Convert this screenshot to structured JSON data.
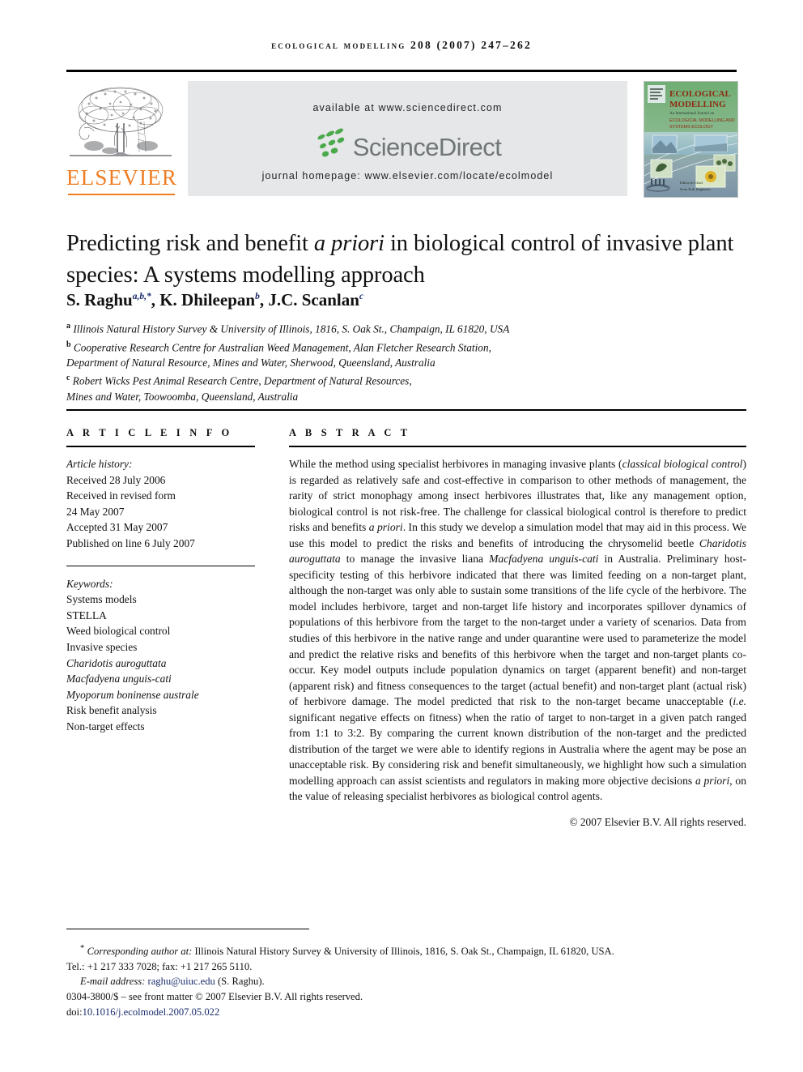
{
  "running_head": "Ecological Modelling 208 (2007) 247–262",
  "masthead": {
    "publisher_name": "ELSEVIER",
    "available_at": "available at www.sciencedirect.com",
    "sciencedirect_wordmark": "ScienceDirect",
    "journal_homepage": "journal homepage: www.elsevier.com/locate/ecolmodel",
    "cover": {
      "journal_title_line1": "ECOLOGICAL",
      "journal_title_line2": "MODELLING",
      "subtitle": "An International Journal on",
      "scope_line1": "ECOLOGICAL MODELLING AND",
      "scope_line2": "SYSTEMS ECOLOGY",
      "editor_label": "Editor-in-Chief",
      "editor_name": "Sven Erik Jørgensen"
    },
    "accent_color": "#ef7d22",
    "panel_color": "#e5e7e8",
    "wordmark_color": "#6f7674",
    "leaf_color": "#4aa94a"
  },
  "article": {
    "title_part1": "Predicting risk and benefit ",
    "title_italic": "a priori",
    "title_part2": " in biological control of invasive plant species: A systems modelling approach",
    "authors": [
      {
        "name": "S. Raghu",
        "marks": "a,b,*"
      },
      {
        "name": "K. Dhileepan",
        "marks": "b"
      },
      {
        "name": "J.C. Scanlan",
        "marks": "c"
      }
    ],
    "affiliations": [
      {
        "mark": "a",
        "lines": [
          "Illinois Natural History Survey & University of Illinois, 1816, S. Oak St., Champaign, IL 61820, USA"
        ]
      },
      {
        "mark": "b",
        "lines": [
          "Cooperative Research Centre for Australian Weed Management, Alan Fletcher Research Station,",
          "Department of Natural Resource, Mines and Water, Sherwood, Queensland, Australia"
        ]
      },
      {
        "mark": "c",
        "lines": [
          "Robert Wicks Pest Animal Research Centre, Department of Natural Resources,",
          "Mines and Water, Toowoomba, Queensland, Australia"
        ]
      }
    ]
  },
  "article_info": {
    "heading": "A R T I C L E    I N F O",
    "history_label": "Article history:",
    "history_lines": [
      "Received 28 July 2006",
      "Received in revised form",
      "24 May 2007",
      "Accepted 31 May 2007",
      "Published on line 6 July 2007"
    ],
    "keywords_label": "Keywords:",
    "keywords": [
      {
        "text": "Systems models",
        "italic": false
      },
      {
        "text": "STELLA",
        "italic": false
      },
      {
        "text": "Weed biological control",
        "italic": false
      },
      {
        "text": "Invasive species",
        "italic": false
      },
      {
        "text": "Charidotis auroguttata",
        "italic": true
      },
      {
        "text": "Macfadyena unguis-cati",
        "italic": true
      },
      {
        "text": "Myoporum boninense australe",
        "italic": true
      },
      {
        "text": "Risk benefit analysis",
        "italic": false
      },
      {
        "text": "Non-target effects",
        "italic": false
      }
    ]
  },
  "abstract": {
    "heading": "A B S T R A C T",
    "segments": [
      {
        "t": "While the method using specialist herbivores in managing invasive plants (",
        "i": false
      },
      {
        "t": "classical biological control",
        "i": true
      },
      {
        "t": ") is regarded as relatively safe and cost-effective in comparison to other methods of management, the rarity of strict monophagy among insect herbivores illustrates that, like any management option, biological control is not risk-free. The challenge for classical biological control is therefore to predict risks and benefits ",
        "i": false
      },
      {
        "t": "a priori",
        "i": true
      },
      {
        "t": ". In this study we develop a simulation model that may aid in this process. We use this model to predict the risks and benefits of introducing the chrysomelid beetle ",
        "i": false
      },
      {
        "t": "Charidotis auroguttata",
        "i": true
      },
      {
        "t": " to manage the invasive liana ",
        "i": false
      },
      {
        "t": "Macfadyena unguis-cati",
        "i": true
      },
      {
        "t": " in Australia. Preliminary host-specificity testing of this herbivore indicated that there was limited feeding on a non-target plant, although the non-target was only able to sustain some transitions of the life cycle of the herbivore. The model includes herbivore, target and non-target life history and incorporates spillover dynamics of populations of this herbivore from the target to the non-target under a variety of scenarios. Data from studies of this herbivore in the native range and under quarantine were used to parameterize the model and predict the relative risks and benefits of this herbivore when the target and non-target plants co-occur. Key model outputs include population dynamics on target (apparent benefit) and non-target (apparent risk) and fitness consequences to the target (actual benefit) and non-target plant (actual risk) of herbivore damage. The model predicted that risk to the non-target became unacceptable (",
        "i": false
      },
      {
        "t": "i.e.",
        "i": true
      },
      {
        "t": " significant negative effects on fitness) when the ratio of target to non-target in a given patch ranged from 1:1 to 3:2. By comparing the current known distribution of the non-target and the predicted distribution of the target we were able to identify regions in Australia where the agent may be pose an unacceptable risk. By considering risk and benefit simultaneously, we highlight how such a simulation modelling approach can assist scientists and regulators in making more objective decisions ",
        "i": false
      },
      {
        "t": "a priori",
        "i": true
      },
      {
        "t": ", on the value of releasing specialist herbivores as biological control agents.",
        "i": false
      }
    ],
    "copyright": "© 2007 Elsevier B.V. All rights reserved."
  },
  "footer": {
    "corresponding_marker": "*",
    "corresponding_label": "Corresponding author at:",
    "corresponding_address": " Illinois Natural History Survey & University of Illinois, 1816, S. Oak St., Champaign, IL 61820, USA.",
    "phone_line": "Tel.: +1 217 333 7028; fax: +1 217 265 5110.",
    "email_label": "E-mail address:",
    "email": "raghu@uiuc.edu",
    "email_owner": "(S. Raghu).",
    "issn_line": "0304-3800/$ – see front matter © 2007 Elsevier B.V. All rights reserved.",
    "doi_label": "doi:",
    "doi": "10.1016/j.ecolmodel.2007.05.022",
    "link_color": "#1a2c6b"
  }
}
